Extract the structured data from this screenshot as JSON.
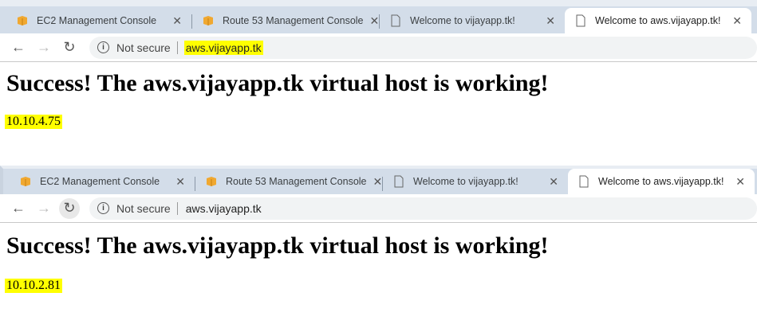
{
  "windows": [
    {
      "tabs": [
        "EC2 Management Console",
        "Route 53 Management Console",
        "Welcome to vijayapp.tk!",
        "Welcome to aws.vijayapp.tk!"
      ],
      "security": "Not secure",
      "url": "aws.vijayapp.tk",
      "heading": "Success! The aws.vijayapp.tk virtual host is working!",
      "ip": "10.10.4.75"
    },
    {
      "tabs": [
        "EC2 Management Console",
        "Route 53 Management Console",
        "Welcome to vijayapp.tk!",
        "Welcome to aws.vijayapp.tk!"
      ],
      "security": "Not secure",
      "url": "aws.vijayapp.tk",
      "heading": "Success! The aws.vijayapp.tk virtual host is working!",
      "ip": "10.10.2.81"
    }
  ],
  "icons": {
    "tab1": "aws-box-icon",
    "tab2": "aws-box-icon",
    "tab3": "page-icon",
    "tab4": "page-icon",
    "close": "close-icon",
    "back": "back-arrow-icon",
    "forward": "forward-arrow-icon",
    "reload": "reload-icon",
    "info": "info-icon"
  },
  "colors": {
    "highlight": "#ffff00",
    "tabstrip": "#d3dde9"
  }
}
